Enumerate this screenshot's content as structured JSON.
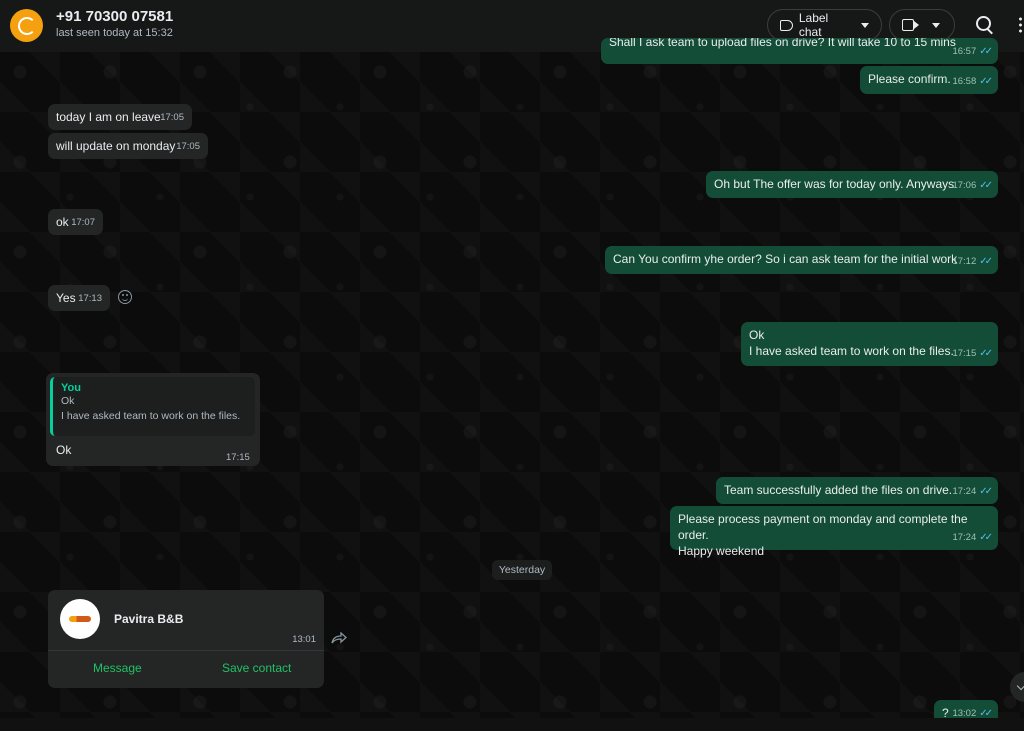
{
  "header": {
    "contact_name": "+91 70300 07581",
    "status": "last seen today at 15:32",
    "label_button": "Label chat"
  },
  "messages": {
    "m1": {
      "text": "Shall I ask team to upload files on drive? It will take 10 to 15 mins",
      "time": "16:57"
    },
    "m2": {
      "text": "Please confirm.",
      "time": "16:58"
    },
    "m3": {
      "text": "today I am on leave",
      "time": "17:05"
    },
    "m4": {
      "text": "will update on monday",
      "time": "17:05"
    },
    "m5": {
      "text": "Oh but The offer was for today only. Anyways",
      "time": "17:06"
    },
    "m6": {
      "text": "ok",
      "time": "17:07"
    },
    "m7": {
      "text": "Can You confirm yhe order? So i can ask team for the initial work",
      "time": "17:12"
    },
    "m8": {
      "text": "Yes",
      "time": "17:13"
    },
    "m9": {
      "text": "Ok\nI have asked team to work on the files.",
      "time": "17:15"
    },
    "m10": {
      "quote_author": "You",
      "quote_line1": "Ok",
      "quote_line2": "I have asked team to work on the files.",
      "text": "Ok",
      "time": "17:15"
    },
    "m11": {
      "text": "Team successfully added the files on drive.",
      "time": "17:24"
    },
    "m12": {
      "text": "Please process payment on monday and complete the order.\nHappy weekend",
      "time": "17:24"
    },
    "m13": {
      "text": "?",
      "time": "13:02"
    }
  },
  "date_separator": "Yesterday",
  "contact_card": {
    "name": "Pavitra B&B",
    "time": "13:01",
    "message_button": "Message",
    "save_button": "Save contact"
  },
  "icons": {
    "label": "label-icon",
    "video": "video-camera-icon",
    "search": "search-icon",
    "menu": "menu-icon",
    "read_receipt": "double-check-icon",
    "emoji": "emoji-icon",
    "forward": "forward-icon",
    "scroll": "chevron-down-icon"
  },
  "colors": {
    "outgoing_bubble": "#144d37",
    "incoming_bubble": "#242626",
    "accent_green": "#21c063",
    "read_tick": "#53bdeb",
    "avatar": "#f5a10f"
  }
}
